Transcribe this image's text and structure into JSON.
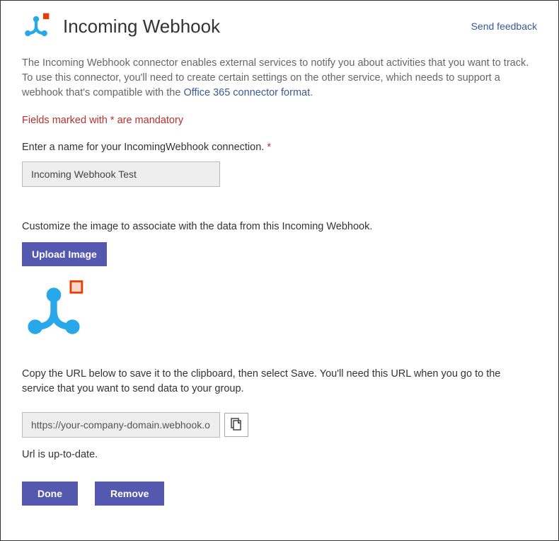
{
  "header": {
    "title": "Incoming Webhook",
    "feedback_label": "Send feedback"
  },
  "description": {
    "text_before_link": "The Incoming Webhook connector enables external services to notify you about activities that you want to track. To use this connector, you'll need to create certain settings on the other service, which needs to support a webhook that's compatible with the ",
    "link_text": "Office 365 connector format",
    "text_after_link": "."
  },
  "mandatory_note": "Fields marked with * are mandatory",
  "name_field": {
    "label": "Enter a name for your IncomingWebhook connection. ",
    "asterisk": "*",
    "value": "Incoming Webhook Test"
  },
  "image_section": {
    "label": "Customize the image to associate with the data from this Incoming Webhook.",
    "upload_label": "Upload Image"
  },
  "url_section": {
    "instruction": "Copy the URL below to save it to the clipboard, then select Save. You'll need this URL when you go to the service that you want to send data to your group.",
    "value": "https://your-company-domain.webhook.o",
    "status": "Url is up-to-date."
  },
  "footer": {
    "done_label": "Done",
    "remove_label": "Remove"
  },
  "colors": {
    "primary": "#5558af",
    "link": "#3b5998",
    "error": "#b83030",
    "icon_blue": "#28a8ea",
    "icon_orange": "#eb3c00"
  }
}
